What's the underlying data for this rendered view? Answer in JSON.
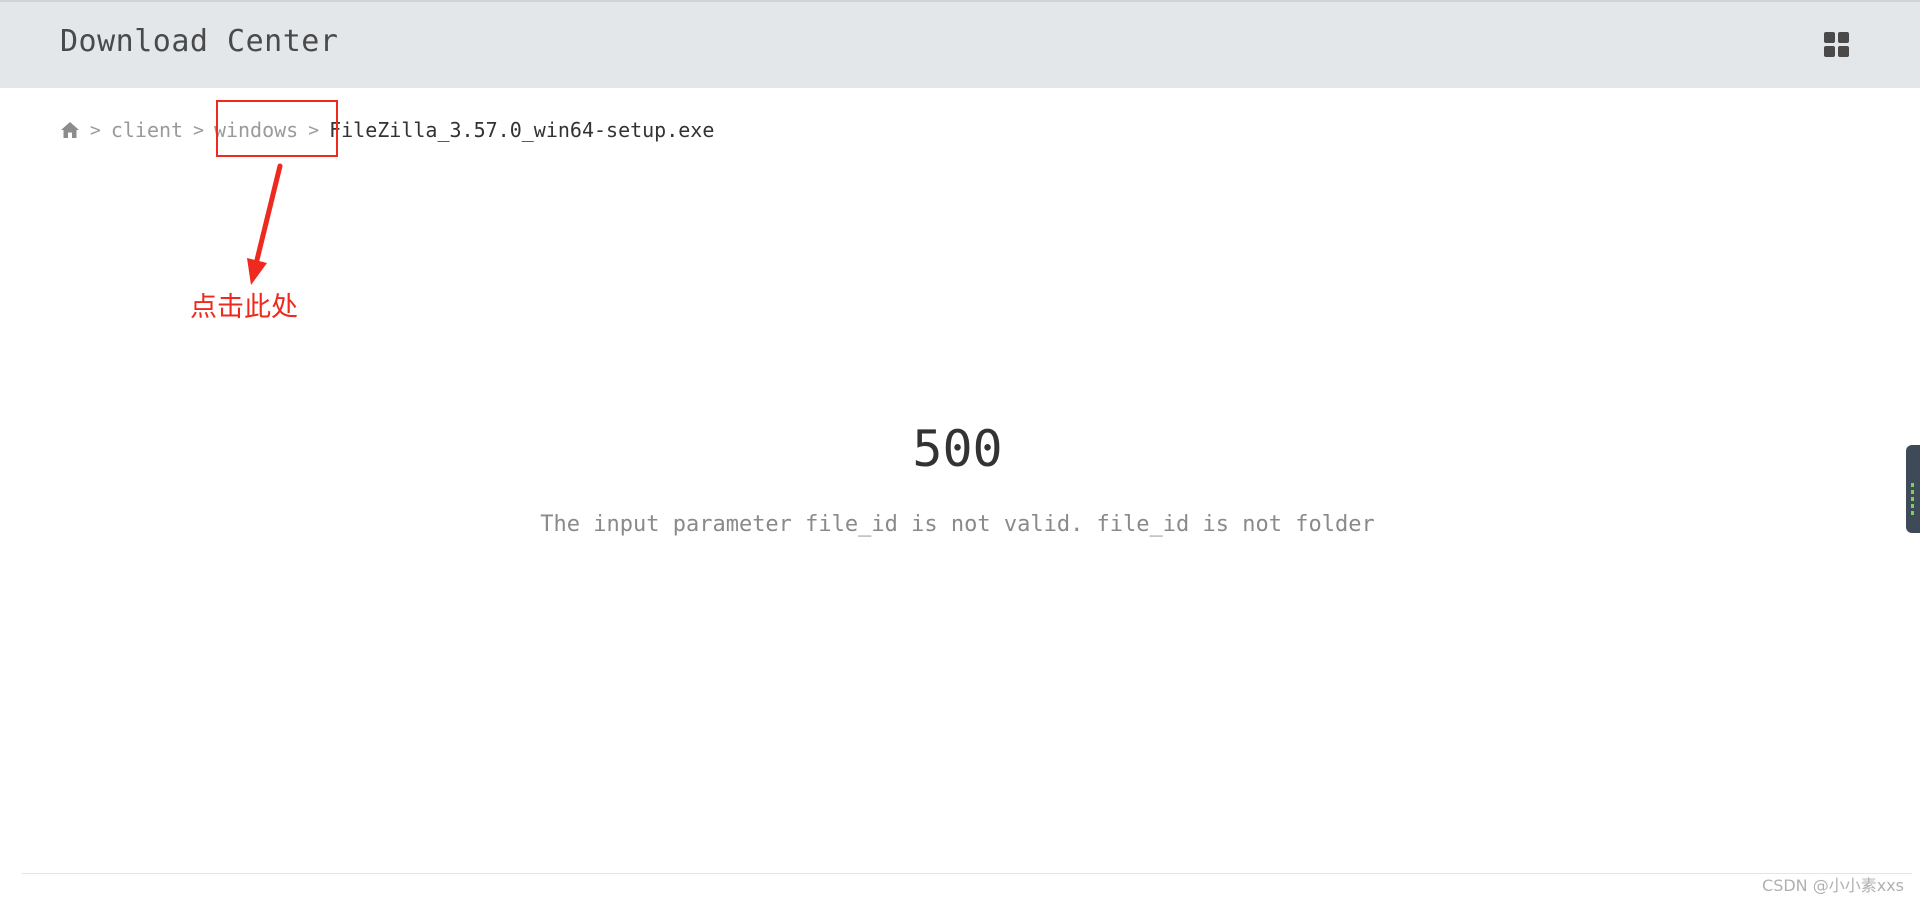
{
  "header": {
    "title": "Download Center",
    "menu_icon": "grid-icon"
  },
  "breadcrumb": {
    "home_icon": "home-icon",
    "separator": ">",
    "items": [
      {
        "label": "client",
        "link": true
      },
      {
        "label": "windows",
        "link": true
      },
      {
        "label": "FileZilla_3.57.0_win64-setup.exe",
        "link": false
      }
    ]
  },
  "annotation": {
    "text": "点击此处",
    "color": "#ee2a1e"
  },
  "error": {
    "code": "500",
    "message": "The input parameter file_id is not valid. file_id is not folder"
  },
  "watermark": "CSDN @小小素xxs",
  "colors": {
    "header_bg": "#e4e7ea",
    "accent_red": "#ee2a1e",
    "text_dark": "#333333",
    "text_muted": "#9a9a9a"
  }
}
